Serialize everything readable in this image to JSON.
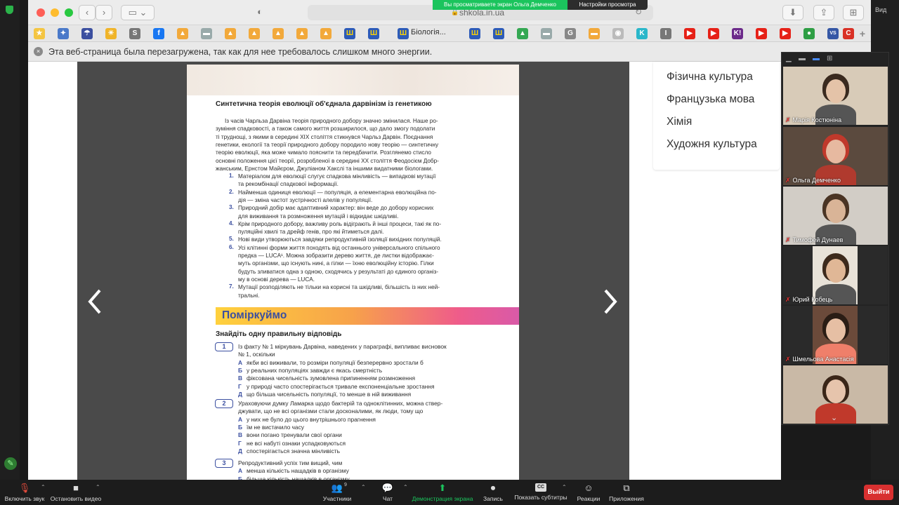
{
  "share": {
    "banner": "Вы просматриваете экран Ольга  Демченко",
    "view_options": "Настройки просмотра"
  },
  "browser": {
    "url": "shkola.in.ua",
    "bookmark_label": "Біологія...",
    "notice": "Эта веб-страница была перезагружена, так как для нее требовалось слишком много энергии."
  },
  "right_strip_label": "Вид",
  "subjects": [
    "Фізична культура",
    "Французька мова",
    "Хімія",
    "Художня культура"
  ],
  "book": {
    "heading": "Синтетична теорія еволюції об'єднала дарвінізм із генетикою",
    "intro": [
      "Із часів Чарльза Дарвіна теорія природного добору значно змінилася. Наше ро-",
      "зуміння спадковості, а також самого життя розширилося, що дало змогу подолати",
      "ті труднощі, з якими в середині XIX століття стикнувся Чарльз Дарвін. Поєднання",
      "генетики, екології та теорії природного добору породило нову теорію — синтетичну",
      "теорію еволюції, яка може чимало пояснити та передбачити. Розглянемо стисло",
      "основні положення цієї теорії, розробленої в середині ХХ століття Феодосієм Добр-",
      "жанським, Ернстом Майєром, Джуліаном Хакслі та іншими видатними біологами."
    ],
    "points": [
      {
        "n": "1.",
        "lines": [
          "Матеріалом для еволюції слугує спадкова мінливість — випадкові мутації",
          "та рекомбінації спадкової інформації."
        ]
      },
      {
        "n": "2.",
        "lines": [
          "Найменша одиниця еволюції — популяція, а елементарна еволюційна по-",
          "дія — зміна частот зустрічності алелів у популяції."
        ]
      },
      {
        "n": "3.",
        "lines": [
          "Природний добір має адаптивний характер: він веде до добору корисних",
          "для виживання та розмноження мутацій і відкидає шкідливі."
        ]
      },
      {
        "n": "4.",
        "lines": [
          "Крім природного добору, важливу роль відіграють й інші процеси, такі як по-",
          "пуляційні хвилі та дрейф генів, про які йтиметься далі."
        ]
      },
      {
        "n": "5.",
        "lines": [
          "Нові види утворюються завдяки репродуктивній ізоляції вихідних популяцій."
        ]
      },
      {
        "n": "6.",
        "lines": [
          "Усі клітинні форми життя походять від останнього універсального спільного",
          "предка — LUCA¹. Можна зобразити дерево життя, де листки відображає-",
          "муть організми, що існують нині, а гілки — їхню еволюційну історію. Гілки",
          "будуть зливатися одна з одною, сходячись у результаті до єдиного організ-",
          "му в основі дерева — LUCA."
        ]
      },
      {
        "n": "7.",
        "lines": [
          "Мутації розподіляють не тільки на корисні та шкідливі, більшість із них ней-",
          "тральні."
        ]
      }
    ],
    "banner": "Поміркуймо",
    "task": "Знайдіть одну правильну відповідь",
    "questions": [
      {
        "n": "1",
        "lines": [
          "Із факту № 1 міркувань Дарвіна, наведених у параграфі, випливає висновок",
          "№ 1, оскільки"
        ],
        "options": [
          {
            "l": "А",
            "t": "якби всі виживали, то розміри популяції безперервно зростали б"
          },
          {
            "l": "Б",
            "t": "у реальних популяціях завжди є якась смертність"
          },
          {
            "l": "В",
            "t": "фіксована чисельність зумовлена припиненням розмноження"
          },
          {
            "l": "Г",
            "t": "у природі часто спостерігається тривале експоненціальне зростання"
          },
          {
            "l": "Д",
            "t": "що більша чисельність популяції, то менше в ній виживання"
          }
        ]
      },
      {
        "n": "2",
        "lines": [
          "Ураховуючи думку Ламарка щодо бактерій та одноклітинних, можна ствер-",
          "джувати, що не всі організми стали досконалими, як люди, тому що"
        ],
        "options": [
          {
            "l": "А",
            "t": "у них не було до цього внутрішнього прагнення"
          },
          {
            "l": "Б",
            "t": "їм не вистачило часу"
          },
          {
            "l": "В",
            "t": "вони погано тренували свої органи"
          },
          {
            "l": "Г",
            "t": "не всі набуті ознаки успадковуються"
          },
          {
            "l": "Д",
            "t": "спостерігається значна мінливість"
          }
        ]
      },
      {
        "n": "3",
        "lines": [
          "Репродуктивний успіх тим вищий, чим"
        ],
        "options": [
          {
            "l": "А",
            "t": "менша кількість нащадків в організму"
          },
          {
            "l": "Б",
            "t": "більша кількість нащадків в організму"
          }
        ]
      }
    ]
  },
  "participants": [
    {
      "name": "Марія Костюніна",
      "bg": "#d8cbb8",
      "face": "#e4c3a8",
      "hair": "#3a2a1f"
    },
    {
      "name": "Ольга  Демченко",
      "bg": "#5b4a3e",
      "face": "#e7b9a0",
      "hair": "#c0392b"
    },
    {
      "name": "Тимофей Дунаев",
      "bg": "#d2cdc6",
      "face": "#d9b497",
      "hair": "#4a3424"
    },
    {
      "name": "Юрий Кобець",
      "bg": "#2c2c2c",
      "face": "#e0b796",
      "hair": "#3d2a1c"
    },
    {
      "name": "Шмельова Анастасія",
      "bg": "#2c2c2c",
      "face": "#e6bfa4",
      "hair": "#2a1d15"
    },
    {
      "name": "",
      "bg": "#c9b9a6",
      "face": "#e6c4ac",
      "hair": "#3a2618"
    }
  ],
  "zoom": {
    "participants_count": "9",
    "items": [
      {
        "label": "Включить звук",
        "icon": "🎙"
      },
      {
        "label": "Остановить видео",
        "icon": "■"
      },
      {
        "label": "Участники",
        "icon": "👥"
      },
      {
        "label": "Чат",
        "icon": "💬"
      },
      {
        "label": "Демонстрация экрана",
        "icon": "⬆"
      },
      {
        "label": "Запись",
        "icon": "⏺"
      },
      {
        "label": "Показать субтитры",
        "icon": "CC"
      },
      {
        "label": "Реакции",
        "icon": "☺"
      },
      {
        "label": "Приложения",
        "icon": "⧉"
      }
    ],
    "leave": "Выйти"
  },
  "colors": {
    "accent_blue": "#3b4fa0",
    "share_green": "#1bc45d",
    "leave_red": "#d83030"
  }
}
